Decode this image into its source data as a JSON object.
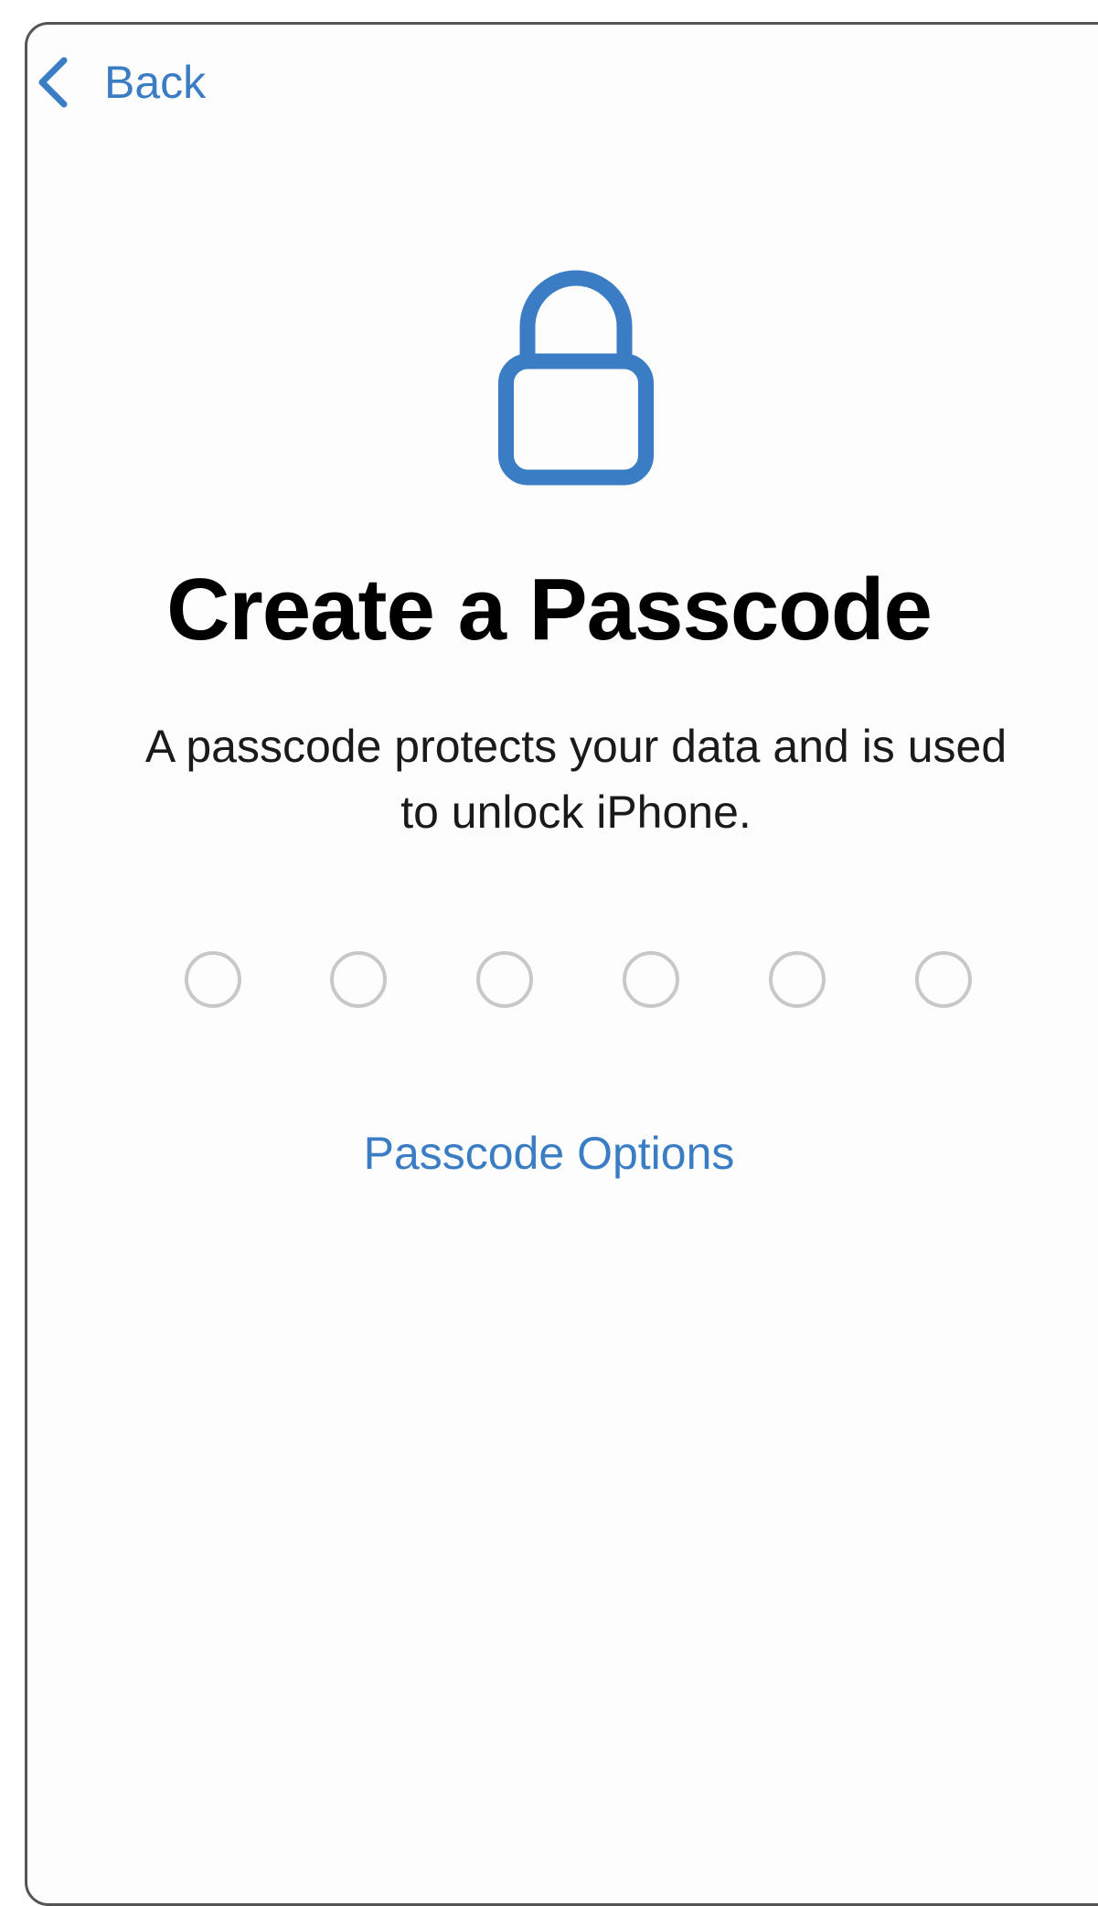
{
  "nav": {
    "back_label": "Back"
  },
  "header": {
    "icon": "lock-icon",
    "title": "Create a Passcode",
    "subtitle_line1": "A passcode protects your data and is used",
    "subtitle_line2": "to unlock iPhone."
  },
  "passcode": {
    "length": 6,
    "entered": 0
  },
  "options": {
    "label": "Passcode Options"
  },
  "colors": {
    "accent": "#3a7dc4",
    "dot_border": "#c8c8c8",
    "title": "#000000"
  }
}
